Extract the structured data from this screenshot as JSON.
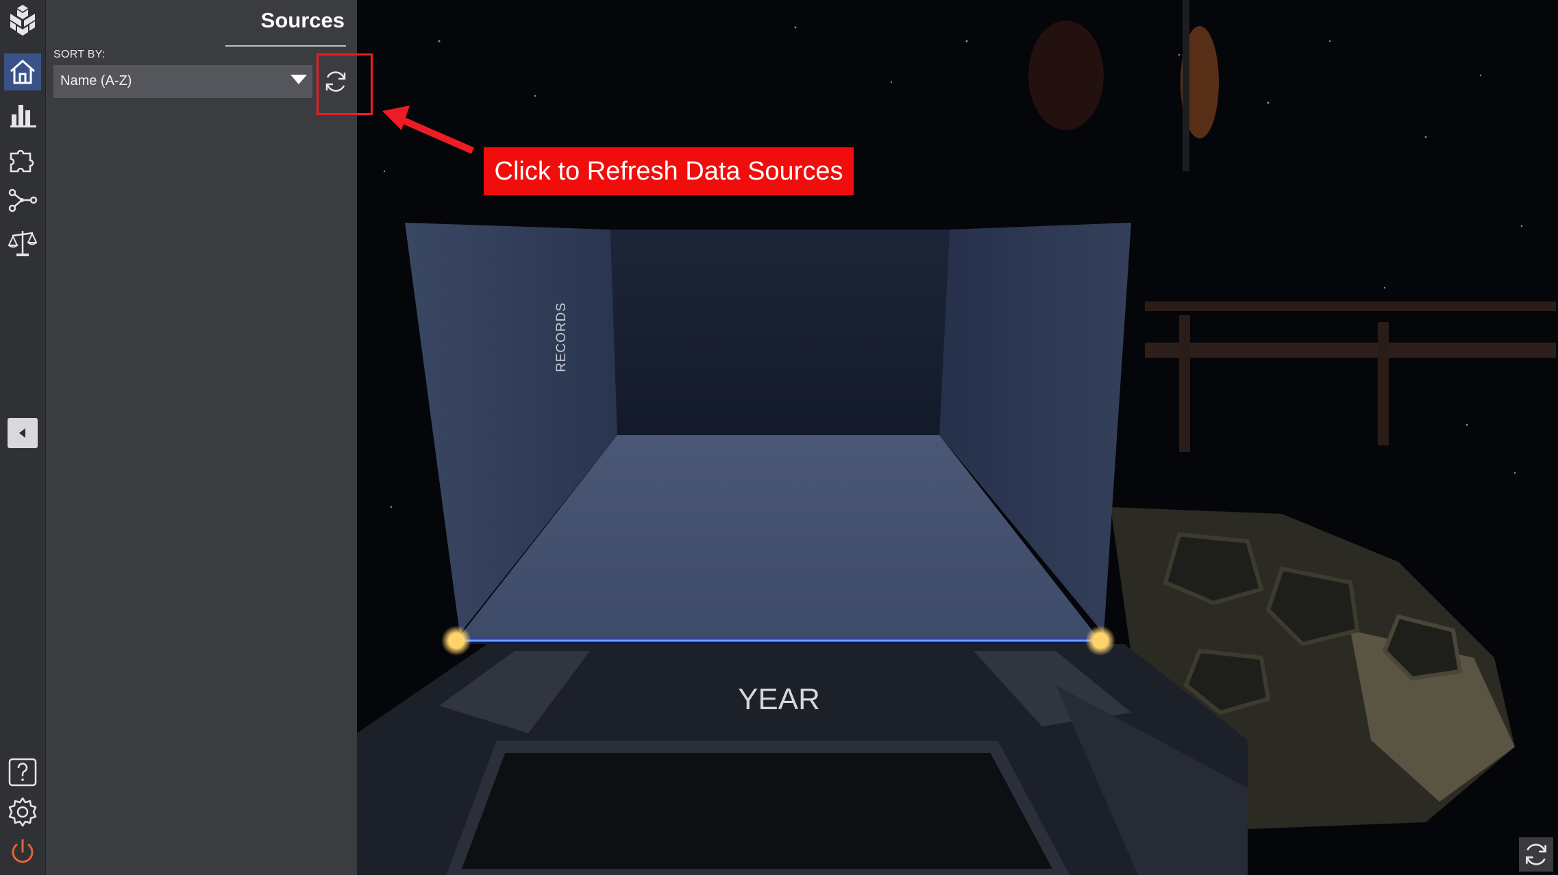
{
  "panel": {
    "title": "Sources",
    "sort_label": "SORT BY:",
    "sort_value": "Name (A-Z)"
  },
  "rail": {
    "items": [
      {
        "icon": "logo-icon"
      },
      {
        "icon": "home-icon",
        "active": true
      },
      {
        "icon": "bar-chart-icon"
      },
      {
        "icon": "puzzle-icon"
      },
      {
        "icon": "graph-network-icon"
      },
      {
        "icon": "scales-icon"
      },
      {
        "icon": "collapse-left-icon"
      },
      {
        "icon": "help-icon"
      },
      {
        "icon": "settings-icon"
      },
      {
        "icon": "power-icon"
      }
    ]
  },
  "scene": {
    "y_axis_label": "RECORDS",
    "x_axis_label": "YEAR"
  },
  "annotation": {
    "callout_text": "Click to Refresh Data Sources"
  },
  "colors": {
    "accent": "#3a5387",
    "annotation_red": "#ee1c24",
    "power": "#e0653b",
    "axis_line": "#3a5bff",
    "axis_endpoint": "#ffd36b"
  }
}
